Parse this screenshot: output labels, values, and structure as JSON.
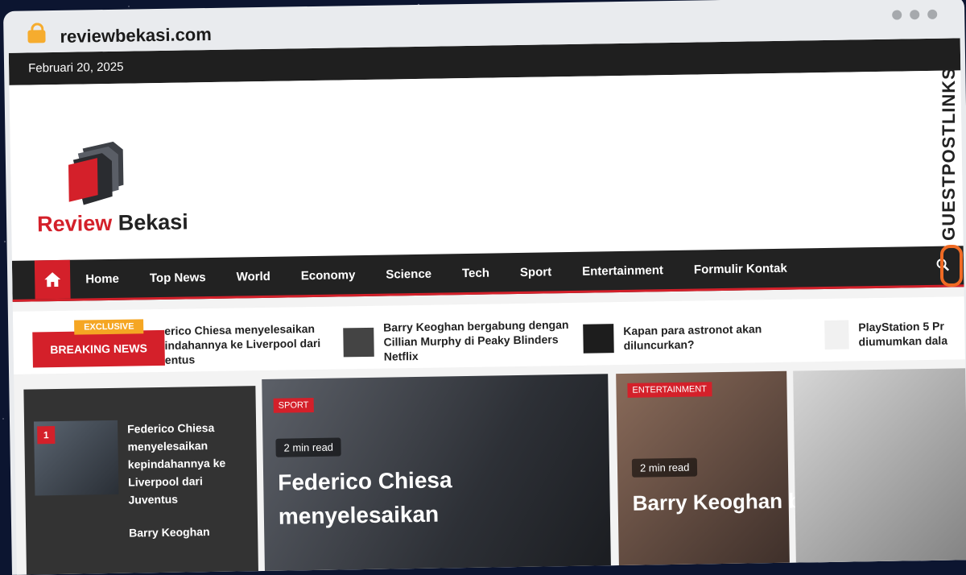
{
  "browser": {
    "url": "reviewbekasi.com"
  },
  "site": {
    "date": "Februari 20, 2025",
    "logo": {
      "word1": "Review",
      "word2": "Bekasi"
    },
    "nav": [
      "Home",
      "Top News",
      "World",
      "Economy",
      "Science",
      "Tech",
      "Sport",
      "Entertainment",
      "Formulir Kontak"
    ],
    "breaking": {
      "badge": "EXCLUSIVE",
      "label": "BREAKING NEWS"
    },
    "ticker": [
      "erico Chiesa menyelesaikan\nindahannya ke Liverpool dari\nentus",
      "Barry Keoghan bergabung dengan Cillian Murphy di Peaky Blinders Netflix",
      "Kapan para astronot akan diluncurkan?",
      "PlayStation 5 Pr\ndiumumkan dala"
    ],
    "sidebar": {
      "item1_num": "1",
      "item1_title": "Federico Chiesa menyelesaikan kepindahannya ke Liverpool dari Juventus",
      "item2_title": "Barry Keoghan"
    },
    "feature_main": {
      "tag": "SPORT",
      "readtime": "2 min read",
      "title": "Federico Chiesa menyelesaikan"
    },
    "feature_side": {
      "tag": "ENTERTAINMENT",
      "readtime": "2 min read",
      "title": "Barry Keoghan bergabung"
    }
  },
  "watermark": "GUESTPOSTLINKS",
  "colors": {
    "accent": "#d4202a",
    "dark": "#222222",
    "badge": "#f5a623"
  }
}
